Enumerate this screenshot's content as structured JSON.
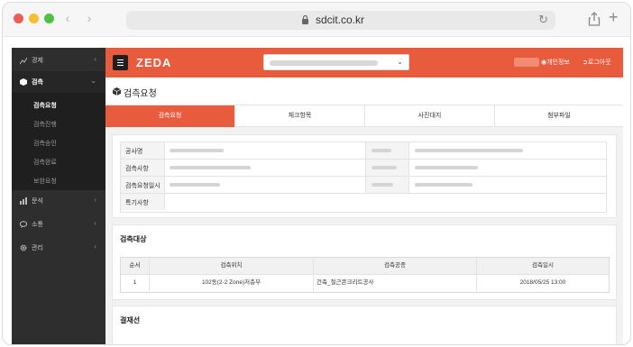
{
  "browser": {
    "url": "sdcit.co.kr"
  },
  "sidebar": {
    "items": [
      {
        "label": "경제",
        "icon": "chart-icon"
      },
      {
        "label": "검측",
        "icon": "box-icon"
      },
      {
        "label": "문석",
        "icon": "bar-chart-icon"
      },
      {
        "label": "소통",
        "icon": "chat-icon"
      },
      {
        "label": "관리",
        "icon": "gear-icon"
      }
    ],
    "submenu": [
      "검측요청",
      "검측진행",
      "검측승인",
      "검측완료",
      "보완요청"
    ]
  },
  "topbar": {
    "logo": "ZEDA",
    "links": [
      "개인정보",
      "로그아웃"
    ]
  },
  "page": {
    "title": "검측요청"
  },
  "tabs": [
    "검측요청",
    "체크항목",
    "사진대지",
    "첨부파일"
  ],
  "info": {
    "rows": [
      "공사명",
      "검측사항",
      "검측요청일시",
      "특기사항"
    ]
  },
  "target": {
    "title": "검측대상",
    "headers": [
      "순서",
      "검측위치",
      "검측공종",
      "검측일시"
    ],
    "rows": [
      {
        "no": "1",
        "location": "102동(2-2 Zone)저층부",
        "work": "건축_철근콘크리트공사",
        "datetime": "2018/05/25 13:00"
      }
    ]
  },
  "approval": {
    "title": "결재선"
  },
  "colors": {
    "accent": "#e95b3d",
    "sidebar": "#2e2e2e"
  }
}
